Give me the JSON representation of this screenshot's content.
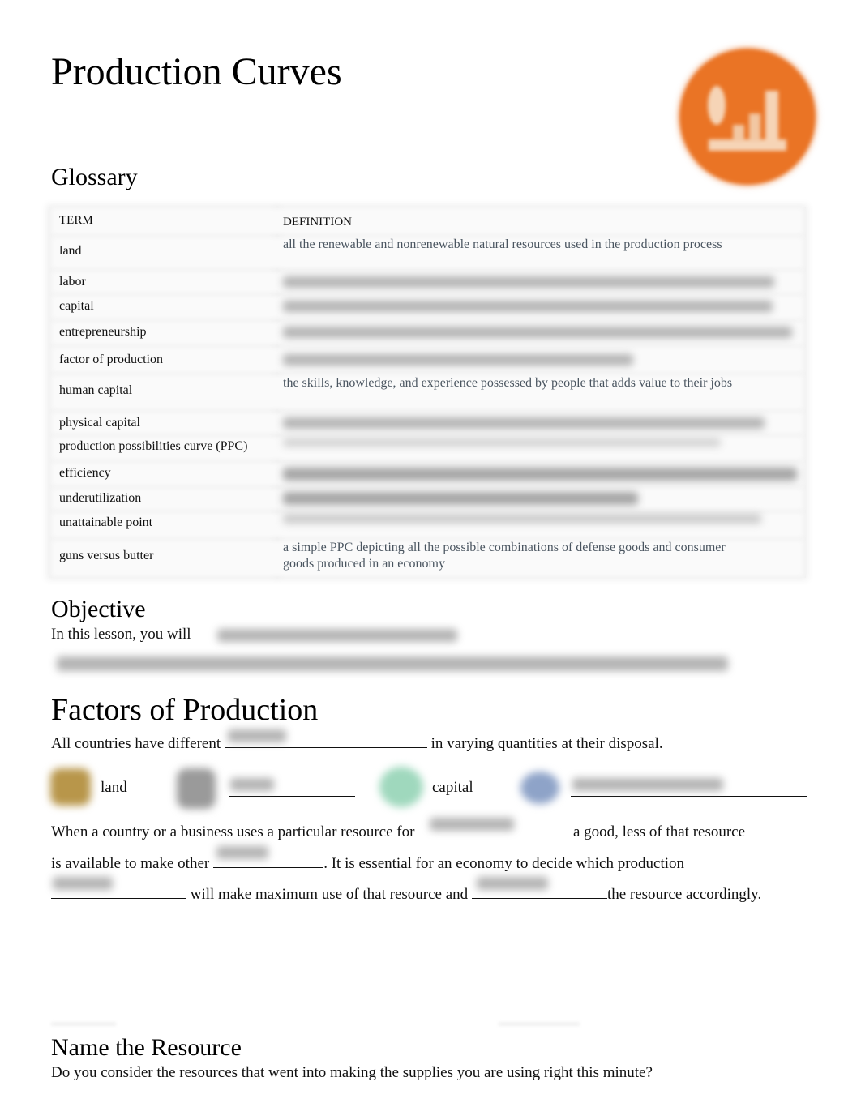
{
  "page": {
    "title": "Production Curves",
    "logo_icon": "dollar-bar-chart-icon",
    "logo_color": "#ea7425"
  },
  "glossary": {
    "heading": "Glossary",
    "columns": [
      "TERM",
      "DEFINITION"
    ],
    "rows": [
      {
        "term": "land",
        "definition": "all the renewable and nonrenewable natural resources used in the production process",
        "definition_visible": true
      },
      {
        "term": "labor",
        "definition": null,
        "definition_visible": false
      },
      {
        "term": "capital",
        "definition": null,
        "definition_visible": false
      },
      {
        "term": "entrepreneurship",
        "definition": null,
        "definition_visible": false
      },
      {
        "term": "factor of production",
        "definition": null,
        "definition_visible": false
      },
      {
        "term": "human capital",
        "definition": "the skills, knowledge, and experience possessed by people that adds value to their jobs",
        "definition_visible": true
      },
      {
        "term": "physical capital",
        "definition": null,
        "definition_visible": false
      },
      {
        "term": "production possibilities curve (PPC)",
        "definition": null,
        "definition_visible": false
      },
      {
        "term": "efficiency",
        "definition": null,
        "definition_visible": false
      },
      {
        "term": "underutilization",
        "definition": null,
        "definition_visible": false
      },
      {
        "term": "unattainable point",
        "definition": null,
        "definition_visible": false
      },
      {
        "term": "guns versus butter",
        "definition": "a simple PPC depicting all the possible combinations of defense goods and consumer goods produced in an economy",
        "definition_visible": true
      }
    ]
  },
  "objective": {
    "heading": "Objective",
    "lead_text": "In this lesson, you will"
  },
  "factors": {
    "heading": "Factors of Production",
    "sentence1_before": "All countries have different",
    "sentence1_after": "in varying quantities at their disposal.",
    "resources": [
      {
        "icon": "land-icon",
        "color": "#b8964a",
        "label": "land",
        "is_blank": false
      },
      {
        "icon": "labor-icon",
        "color": "#9a9a9a",
        "label": "",
        "is_blank": true
      },
      {
        "icon": "capital-icon",
        "color": "#9fd8bd",
        "label": "capital",
        "is_blank": false
      },
      {
        "icon": "entrepreneurship-icon",
        "color": "#8ea3c8",
        "label": "",
        "is_blank": true
      }
    ],
    "para_line1_before": "When a country or a business uses a particular resource for",
    "para_line1_after": "a good, less of that resource",
    "para_line2_before": "is available to make other",
    "para_line2_after": ". It is essential for an economy to decide which production",
    "para_line3_mid": "will make maximum use of that resource and",
    "para_line3_after": "the resource accordingly."
  },
  "name_resource": {
    "heading": "Name the Resource",
    "question": "Do you consider the resources that went into making the supplies you are using right this minute?"
  }
}
